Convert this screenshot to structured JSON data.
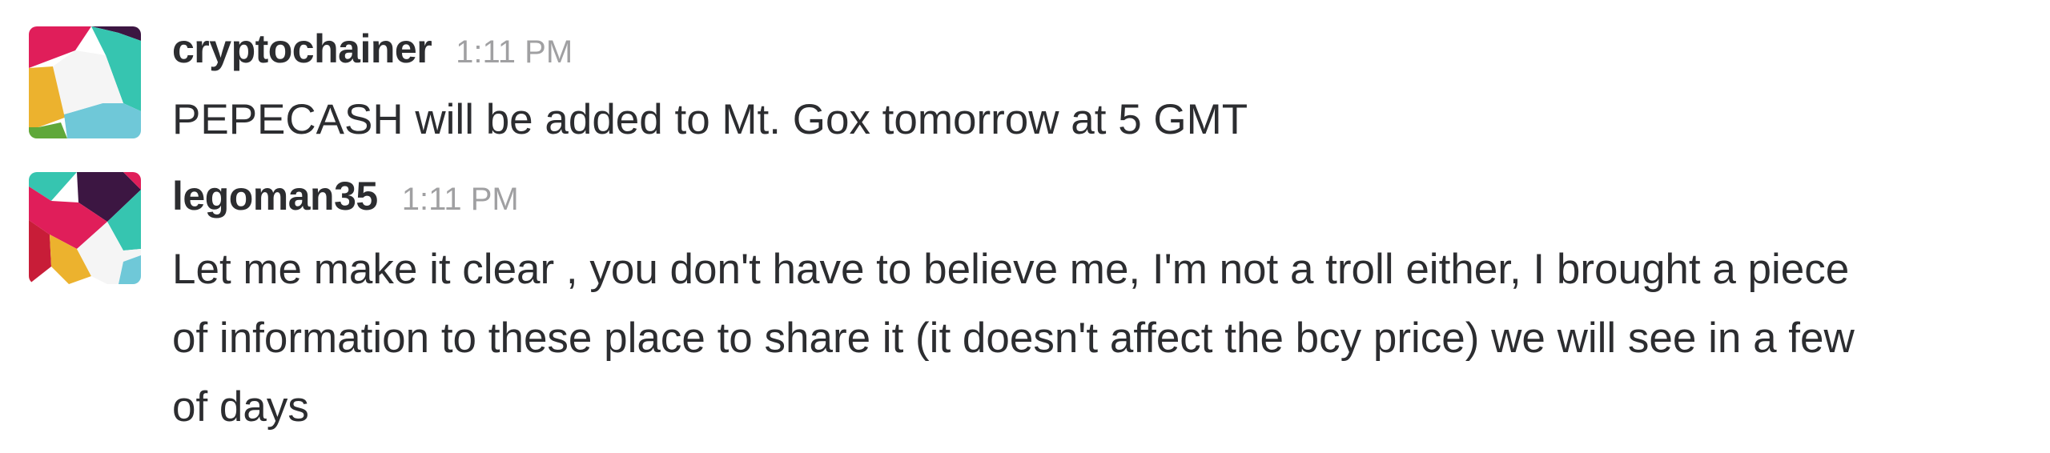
{
  "messages": [
    {
      "username": "cryptochainer",
      "time": "1:11 PM",
      "avatar_icon": "geometric-avatar-icon",
      "lines": [
        "PEPECASH will be added to Mt. Gox tomorrow at 5 GMT"
      ]
    },
    {
      "username": "legoman35",
      "time": "1:11 PM",
      "avatar_icon": "geometric-avatar-icon",
      "lines": [
        "Let me make it clear , you don't have to believe me, I'm not a troll either, I brought a piece",
        "of information to these place to share it (it doesn't affect the bcy price) we will see in a few",
        "of days"
      ]
    }
  ],
  "colors": {
    "text": "#2c2d30",
    "timestamp": "#a0a0a2",
    "avatar_palette": [
      "#e01e5a",
      "#36c5b0",
      "#3c1642",
      "#ecb22e",
      "#6fc8d8",
      "#5fa83a",
      "#ffffff"
    ]
  }
}
